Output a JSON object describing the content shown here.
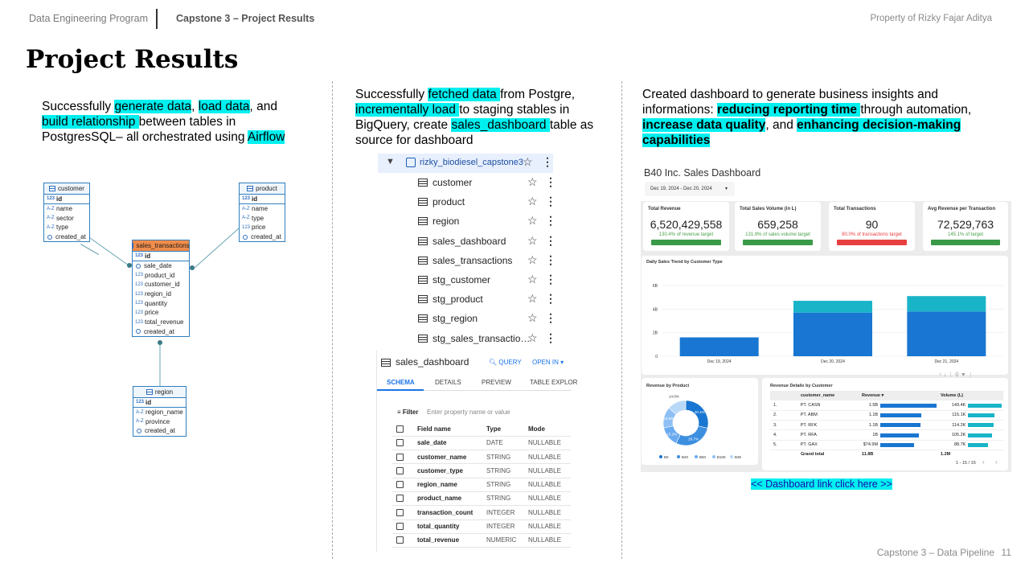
{
  "header": {
    "program": "Data Engineering Program",
    "capstone": "Capstone 3 – Project Results",
    "property": "Property of Rizky Fajar Aditya"
  },
  "title": "Project Results",
  "col1": {
    "t1": "Successfully ",
    "h1": "generate data",
    "t2": ", ",
    "h2": "load data",
    "t3": ", and",
    "h3": "build relationship ",
    "t4": "between tables in",
    "t5": "PostgresSQL– all orchestrated using ",
    "h4": "Airflow"
  },
  "erd": {
    "customer": {
      "name": "customer",
      "pk": "id",
      "cols": [
        {
          "t": "A-Z",
          "n": "name"
        },
        {
          "t": "A-Z",
          "n": "sector"
        },
        {
          "t": "A-Z",
          "n": "type"
        },
        {
          "t": "clock",
          "n": "created_at"
        }
      ]
    },
    "product": {
      "name": "product",
      "pk": "id",
      "cols": [
        {
          "t": "A-Z",
          "n": "name"
        },
        {
          "t": "A-Z",
          "n": "type"
        },
        {
          "t": "123",
          "n": "price"
        },
        {
          "t": "clock",
          "n": "created_at"
        }
      ]
    },
    "sales": {
      "name": "sales_transactions",
      "pk": "id",
      "cols": [
        {
          "t": "clock",
          "n": "sale_date"
        },
        {
          "t": "123",
          "n": "product_id"
        },
        {
          "t": "123",
          "n": "customer_id"
        },
        {
          "t": "123",
          "n": "region_id"
        },
        {
          "t": "123",
          "n": "quantity"
        },
        {
          "t": "123",
          "n": "price"
        },
        {
          "t": "123",
          "n": "total_revenue"
        },
        {
          "t": "clock",
          "n": "created_at"
        }
      ]
    },
    "region": {
      "name": "region",
      "pk": "id",
      "cols": [
        {
          "t": "A-Z",
          "n": "region_name"
        },
        {
          "t": "A-Z",
          "n": "province"
        },
        {
          "t": "clock",
          "n": "created_at"
        }
      ]
    },
    "pk_type": "123"
  },
  "col2": {
    "t1": "Successfully ",
    "h1": "fetched data ",
    "t2": "from Postgre,",
    "h2": "incrementally load ",
    "t3": "to staging stables in",
    "t4": "BigQuery, create ",
    "h3": "sales_dashboard ",
    "t5": "table as",
    "t6": "source for dashboard"
  },
  "bq": {
    "dataset": "rizky_biodiesel_capstone3",
    "tables": [
      "customer",
      "product",
      "region",
      "sales_dashboard",
      "sales_transactions",
      "stg_customer",
      "stg_product",
      "stg_region",
      "stg_sales_transactio…"
    ],
    "schema_title": "sales_dashboard",
    "query": "QUERY",
    "open_in": "OPEN IN",
    "tabs": [
      "SCHEMA",
      "DETAILS",
      "PREVIEW",
      "TABLE EXPLOR"
    ],
    "filter_label": "Filter",
    "filter_placeholder": "Enter property name or value",
    "headers": [
      "Field name",
      "Type",
      "Mode"
    ],
    "fields": [
      {
        "name": "sale_date",
        "type": "DATE",
        "mode": "NULLABLE"
      },
      {
        "name": "customer_name",
        "type": "STRING",
        "mode": "NULLABLE"
      },
      {
        "name": "customer_type",
        "type": "STRING",
        "mode": "NULLABLE"
      },
      {
        "name": "region_name",
        "type": "STRING",
        "mode": "NULLABLE"
      },
      {
        "name": "product_name",
        "type": "STRING",
        "mode": "NULLABLE"
      },
      {
        "name": "transaction_count",
        "type": "INTEGER",
        "mode": "NULLABLE"
      },
      {
        "name": "total_quantity",
        "type": "INTEGER",
        "mode": "NULLABLE"
      },
      {
        "name": "total_revenue",
        "type": "NUMERIC",
        "mode": "NULLABLE"
      }
    ]
  },
  "col3": {
    "t1": "Created dashboard to generate business insights and",
    "t2": "informations: ",
    "h1": "reducing reporting time ",
    "t3": "through automation,",
    "h2": "increase data quality",
    "t4": ", and ",
    "h3": "enhancing decision-making ",
    "h4": "capabilities"
  },
  "dashboard": {
    "title": "B40 Inc. Sales Dashboard",
    "date_range": "Dec 19, 2024 - Dec 20, 2024",
    "kpis": [
      {
        "title": "Total Revenue",
        "value": "6,520,429,558",
        "sub": "130.4% of revenue target",
        "color": "#3a9a48",
        "sub_color": "#4aa04a"
      },
      {
        "title": "Total Sales Volume (in L)",
        "value": "659,258",
        "sub": "131.9% of sales volume target",
        "color": "#3a9a48",
        "sub_color": "#4aa04a"
      },
      {
        "title": "Total Transactions",
        "value": "90",
        "sub": "90.0% of transactions target",
        "color": "#e84040",
        "sub_color": "#e84040"
      },
      {
        "title": "Avg Revenue per Transaction",
        "value": "72,529,763",
        "sub": "145.1% of target",
        "color": "#3a9a48",
        "sub_color": "#4aa04a"
      }
    ],
    "trend_title": "Daily Sales Trend by Customer Type",
    "chart_data": {
      "type": "bar",
      "categories": [
        "Dec 19, 2024",
        "Dec 20, 2024",
        "Dec 21, 2024"
      ],
      "series": [
        {
          "values": [
            1.6,
            3.7,
            3.8
          ],
          "color": "#1976d2"
        },
        {
          "values": [
            0,
            1.0,
            1.3
          ],
          "color": "#19b4c8"
        }
      ],
      "ytick_labels": [
        "0",
        "2B",
        "4B",
        "6B"
      ],
      "ylim": [
        0,
        6
      ]
    },
    "pie_title": "Revenue by Product",
    "pie_data": {
      "type": "pie",
      "labels": [
        "B0",
        "B40",
        "B50",
        "B100",
        "B35"
      ],
      "values": [
        30.1,
        29.7,
        15.2,
        15.9,
        14.0
      ],
      "value_labels": [
        "30.1%",
        "29.7%",
        "15.2%",
        "15.9%",
        "14.0%"
      ],
      "colors": [
        "#1976d2",
        "#3d8fe0",
        "#6aaaf0",
        "#8fc0f5",
        "#b8d8f8"
      ]
    },
    "table_title": "Revenue Details by Customer",
    "table_headers": [
      "customer_name",
      "Revenue ▾",
      "Volume (L)"
    ],
    "table_rows": [
      {
        "num": "1.",
        "name": "PT. CASN",
        "rev": "1.5B",
        "rev_frac": 1.0,
        "vol": "149.4K",
        "vol_frac": 1.0
      },
      {
        "num": "2.",
        "name": "PT. ABM",
        "rev": "1.1B",
        "rev_frac": 0.73,
        "vol": "115.1K",
        "vol_frac": 0.77
      },
      {
        "num": "3.",
        "name": "PT. RFK",
        "rev": "1.1B",
        "rev_frac": 0.72,
        "vol": "114.2K",
        "vol_frac": 0.76
      },
      {
        "num": "4.",
        "name": "PT. RFA",
        "rev": "1B",
        "rev_frac": 0.68,
        "vol": "105.2K",
        "vol_frac": 0.7
      },
      {
        "num": "5.",
        "name": "PT. GAX",
        "rev": "$74.9M",
        "rev_frac": 0.6,
        "vol": "88.7K",
        "vol_frac": 0.59
      }
    ],
    "table_total": {
      "label": "Grand total",
      "rev": "11.8B",
      "vol": "1.2M"
    },
    "pagination": "1 - 15 / 15"
  },
  "dashboard_link": "<< Dashboard link click here >>",
  "footer": {
    "label": "Capstone 3 – Data Pipeline",
    "page": "11"
  }
}
